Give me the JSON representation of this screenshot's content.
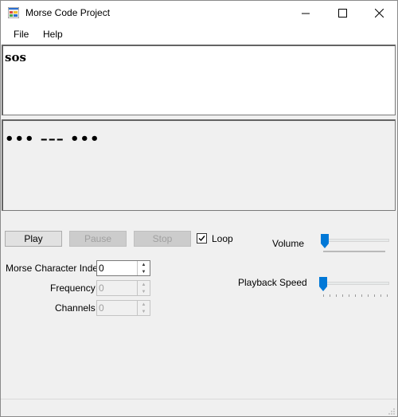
{
  "window": {
    "title": "Morse Code Project"
  },
  "menu": {
    "file": "File",
    "help": "Help"
  },
  "input_text": "sos",
  "morse_text": "••• ––– •••",
  "buttons": {
    "play": "Play",
    "pause": "Pause",
    "stop": "Stop"
  },
  "loop": {
    "label": "Loop",
    "checked": true
  },
  "fields": {
    "morse_index": {
      "label": "Morse Character Index",
      "value": "0"
    },
    "frequency": {
      "label": "Frequency",
      "value": "0"
    },
    "channels": {
      "label": "Channels",
      "value": "0"
    }
  },
  "sliders": {
    "volume": {
      "label": "Volume",
      "level": 0
    },
    "speed": {
      "label": "Playback Speed",
      "level": 0
    }
  },
  "colors": {
    "accent": "#0078d7"
  }
}
